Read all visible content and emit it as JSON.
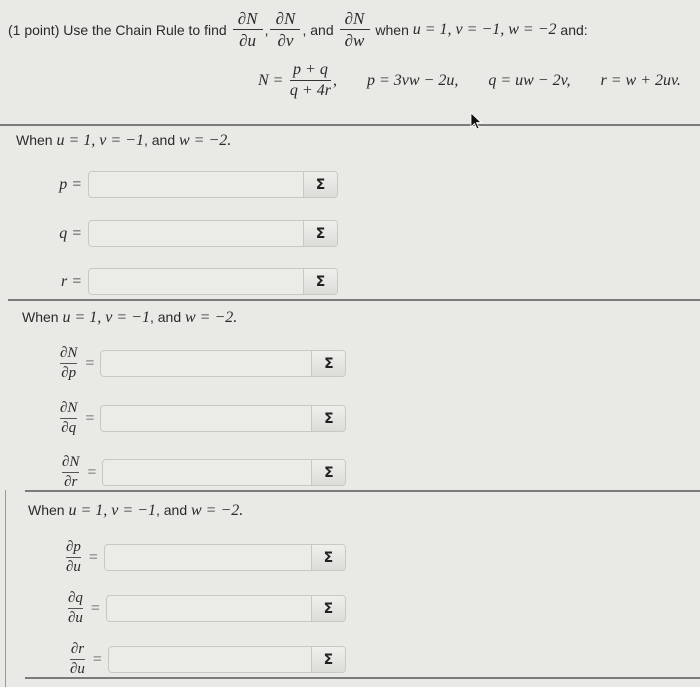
{
  "header": {
    "prefix": "(1 point) Use the Chain Rule to find",
    "derivatives": [
      {
        "num": "∂N",
        "den": "∂u"
      },
      {
        "num": "∂N",
        "den": "∂v"
      },
      {
        "num": "∂N",
        "den": "∂w"
      }
    ],
    "comma": ",",
    "and": ", and",
    "when_word": "when",
    "condition": "u = 1, v = −1, w = −2",
    "suffix": "and:"
  },
  "formula": {
    "N_lhs": "N =",
    "N_num": "p + q",
    "N_den": "q + 4r",
    "N_tail": ",",
    "p_def": "p = 3vw − 2u,",
    "q_def": "q = uw − 2v,",
    "r_def": "r = w + 2uv."
  },
  "sections": [
    {
      "when_prefix": "When",
      "when_math": "u = 1, v = −1",
      "when_and": ", and",
      "when_math2": "w = −2.",
      "fields": [
        {
          "label": "p =",
          "value": "",
          "sigma": "Σ"
        },
        {
          "label": "q =",
          "value": "",
          "sigma": "Σ"
        },
        {
          "label": "r =",
          "value": "",
          "sigma": "Σ"
        }
      ]
    },
    {
      "when_prefix": "When",
      "when_math": "u = 1, v = −1",
      "when_and": ", and",
      "when_math2": "w = −2.",
      "fields": [
        {
          "num": "∂N",
          "den": "∂p",
          "eq": "=",
          "value": "",
          "sigma": "Σ"
        },
        {
          "num": "∂N",
          "den": "∂q",
          "eq": "=",
          "value": "",
          "sigma": "Σ"
        },
        {
          "num": "∂N",
          "den": "∂r",
          "eq": "=",
          "value": "",
          "sigma": "Σ"
        }
      ]
    },
    {
      "when_prefix": "When",
      "when_math": "u = 1, v = −1",
      "when_and": ", and",
      "when_math2": "w = −2.",
      "fields": [
        {
          "num": "∂p",
          "den": "∂u",
          "eq": "=",
          "value": "",
          "sigma": "Σ"
        },
        {
          "num": "∂q",
          "den": "∂u",
          "eq": "=",
          "value": "",
          "sigma": "Σ"
        },
        {
          "num": "∂r",
          "den": "∂u",
          "eq": "=",
          "value": "",
          "sigma": "Σ"
        }
      ]
    }
  ],
  "icons": {
    "sigma": "sigma-icon",
    "cursor": "mouse-pointer-icon"
  }
}
